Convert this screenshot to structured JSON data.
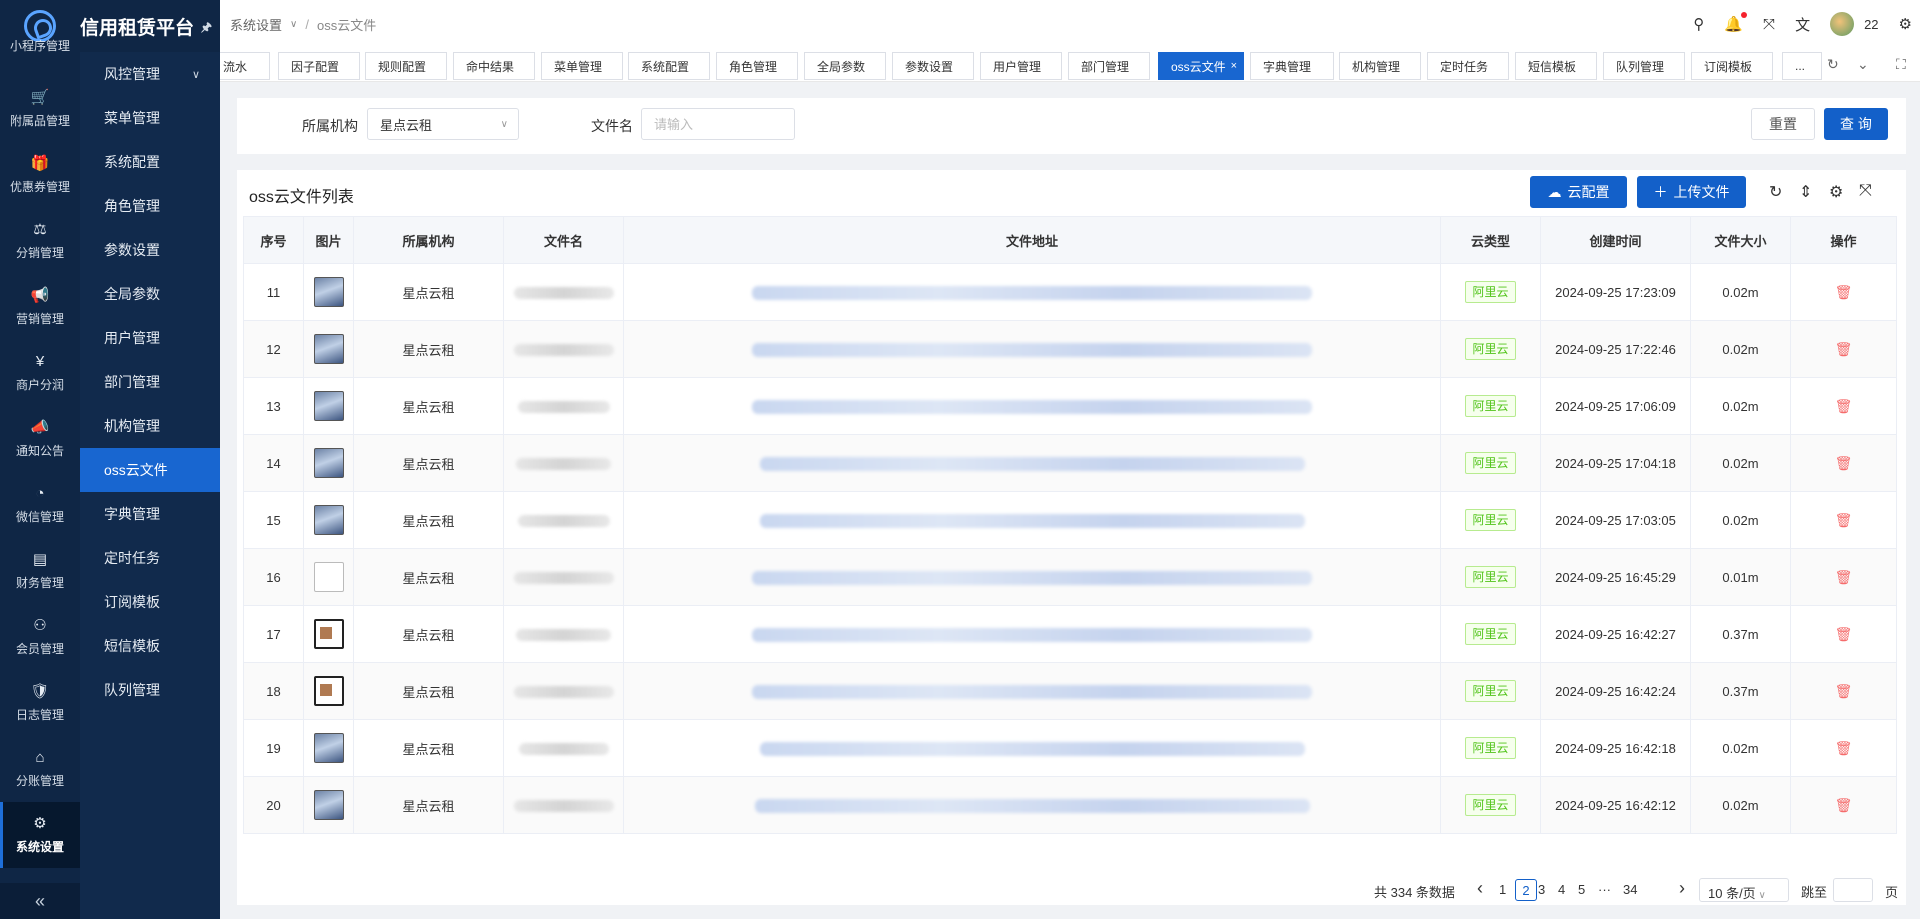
{
  "brand": {
    "title": "信用租赁平台"
  },
  "rail": {
    "items": [
      {
        "label": "小程序管理",
        "icon": "mini-program-icon"
      },
      {
        "label": "附属品管理",
        "icon": "cart-icon"
      },
      {
        "label": "优惠券管理",
        "icon": "gift-icon"
      },
      {
        "label": "分销管理",
        "icon": "sliders-icon"
      },
      {
        "label": "营销管理",
        "icon": "megaphone-icon"
      },
      {
        "label": "商户分润",
        "icon": "yen-icon"
      },
      {
        "label": "通知公告",
        "icon": "announce-icon"
      },
      {
        "label": "微信管理",
        "icon": "wechat-icon"
      },
      {
        "label": "财务管理",
        "icon": "finance-icon"
      },
      {
        "label": "会员管理",
        "icon": "member-icon"
      },
      {
        "label": "日志管理",
        "icon": "shield-check-icon"
      },
      {
        "label": "分账管理",
        "icon": "split-icon"
      },
      {
        "label": "系统设置",
        "icon": "gear-icon"
      }
    ],
    "collapse": "«"
  },
  "submenu": {
    "items": [
      "风控管理",
      "菜单管理",
      "系统配置",
      "角色管理",
      "参数设置",
      "全局参数",
      "用户管理",
      "部门管理",
      "机构管理",
      "oss云文件",
      "字典管理",
      "定时任务",
      "订阅模板",
      "短信模板",
      "队列管理"
    ]
  },
  "header": {
    "breadcrumb": [
      "系统设置",
      "oss云文件"
    ],
    "user_count": "22"
  },
  "tabs": [
    "流水",
    "因子配置",
    "规则配置",
    "命中结果",
    "菜单管理",
    "系统配置",
    "角色管理",
    "全局参数",
    "参数设置",
    "用户管理",
    "部门管理",
    "oss云文件",
    "字典管理",
    "机构管理",
    "定时任务",
    "短信模板",
    "队列管理",
    "订阅模板",
    "..."
  ],
  "search": {
    "org_label": "所属机构",
    "org_value": "星点云租",
    "filename_label": "文件名",
    "filename_placeholder": "请输入",
    "reset": "重置",
    "query": "查 询"
  },
  "panel": {
    "title": "oss云文件列表",
    "cloud_config": "云配置",
    "upload": "上传文件"
  },
  "table": {
    "columns": [
      "序号",
      "图片",
      "所属机构",
      "文件名",
      "文件地址",
      "云类型",
      "创建时间",
      "文件大小",
      "操作"
    ],
    "rows": [
      {
        "no": "11",
        "thumb": "img",
        "org": "星点云租",
        "cloud": "阿里云",
        "time": "2024-09-25 17:23:09",
        "size": "0.02m"
      },
      {
        "no": "12",
        "thumb": "img",
        "org": "星点云租",
        "cloud": "阿里云",
        "time": "2024-09-25 17:22:46",
        "size": "0.02m"
      },
      {
        "no": "13",
        "thumb": "img",
        "org": "星点云租",
        "cloud": "阿里云",
        "time": "2024-09-25 17:06:09",
        "size": "0.02m"
      },
      {
        "no": "14",
        "thumb": "img",
        "org": "星点云租",
        "cloud": "阿里云",
        "time": "2024-09-25 17:04:18",
        "size": "0.02m"
      },
      {
        "no": "15",
        "thumb": "img",
        "org": "星点云租",
        "cloud": "阿里云",
        "time": "2024-09-25 17:03:05",
        "size": "0.02m"
      },
      {
        "no": "16",
        "thumb": "blank",
        "org": "星点云租",
        "cloud": "阿里云",
        "time": "2024-09-25 16:45:29",
        "size": "0.01m"
      },
      {
        "no": "17",
        "thumb": "doc",
        "org": "星点云租",
        "cloud": "阿里云",
        "time": "2024-09-25 16:42:27",
        "size": "0.37m"
      },
      {
        "no": "18",
        "thumb": "doc",
        "org": "星点云租",
        "cloud": "阿里云",
        "time": "2024-09-25 16:42:24",
        "size": "0.37m"
      },
      {
        "no": "19",
        "thumb": "img",
        "org": "星点云租",
        "cloud": "阿里云",
        "time": "2024-09-25 16:42:18",
        "size": "0.02m"
      },
      {
        "no": "20",
        "thumb": "img",
        "org": "星点云租",
        "cloud": "阿里云",
        "time": "2024-09-25 16:42:12",
        "size": "0.02m"
      }
    ]
  },
  "pagination": {
    "total": "共 334 条数据",
    "pages": [
      "1",
      "2",
      "3",
      "4",
      "5",
      "···",
      "34"
    ],
    "current": "2",
    "page_size": "10 条/页",
    "jump_label": "跳至",
    "jump_suffix": "页"
  },
  "colors": {
    "primary": "#1360c9",
    "rail_bg": "#0f2645",
    "submenu_bg": "#112a4c",
    "tag_green": "#52c41a"
  }
}
